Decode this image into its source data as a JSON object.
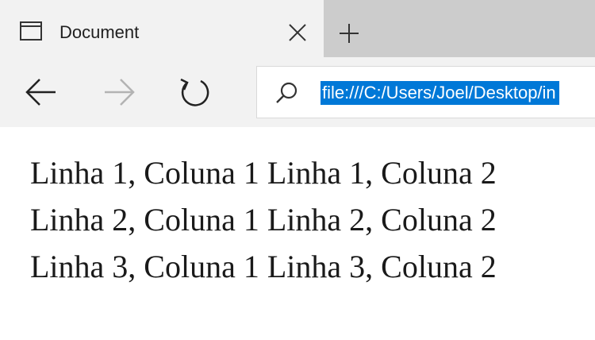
{
  "tab": {
    "title": "Document",
    "icon": "page-icon",
    "close_icon": "close-icon"
  },
  "new_tab_icon": "plus-icon",
  "navigation": {
    "back_icon": "arrow-left-icon",
    "forward_icon": "arrow-right-icon",
    "refresh_icon": "refresh-icon"
  },
  "address_bar": {
    "search_icon": "search-icon",
    "url": "file:///C:/Users/Joel/Desktop/in",
    "selection_color": "#0078d7"
  },
  "table": {
    "rows": [
      [
        "Linha 1, Coluna 1",
        "Linha 1, Coluna 2"
      ],
      [
        "Linha 2, Coluna 1",
        "Linha 2, Coluna 2"
      ],
      [
        "Linha 3, Coluna 1",
        "Linha 3, Coluna 2"
      ]
    ]
  }
}
